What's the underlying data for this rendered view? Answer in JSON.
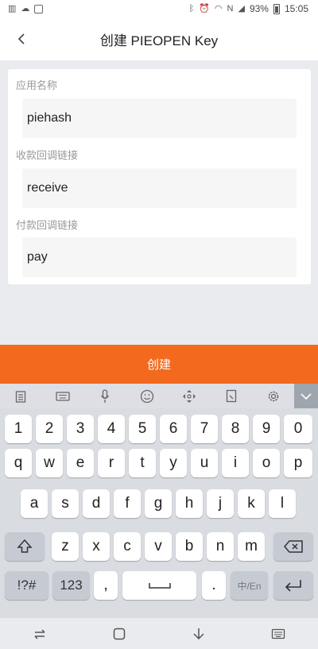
{
  "status_bar": {
    "battery": "93%",
    "time": "15:05"
  },
  "header": {
    "title": "创建 PIEOPEN Key"
  },
  "form": {
    "fields": [
      {
        "label": "应用名称",
        "value": "piehash"
      },
      {
        "label": "收款回调链接",
        "value": "receive"
      },
      {
        "label": "付款回调链接",
        "value": "pay"
      }
    ]
  },
  "actions": {
    "create_label": "创建"
  },
  "keyboard": {
    "row_numbers": [
      "1",
      "2",
      "3",
      "4",
      "5",
      "6",
      "7",
      "8",
      "9",
      "0"
    ],
    "row_top": [
      "q",
      "w",
      "e",
      "r",
      "t",
      "y",
      "u",
      "i",
      "o",
      "p"
    ],
    "row_mid": [
      "a",
      "s",
      "d",
      "f",
      "g",
      "h",
      "j",
      "k",
      "l"
    ],
    "row_bottom": [
      "z",
      "x",
      "c",
      "v",
      "b",
      "n",
      "m"
    ],
    "symbols_label": "!?#",
    "numbers_label": "123",
    "comma_label": ",",
    "period_label": ".",
    "lang_label": "中/En"
  },
  "colors": {
    "accent": "#f36a1f",
    "background": "#e9ebef"
  }
}
